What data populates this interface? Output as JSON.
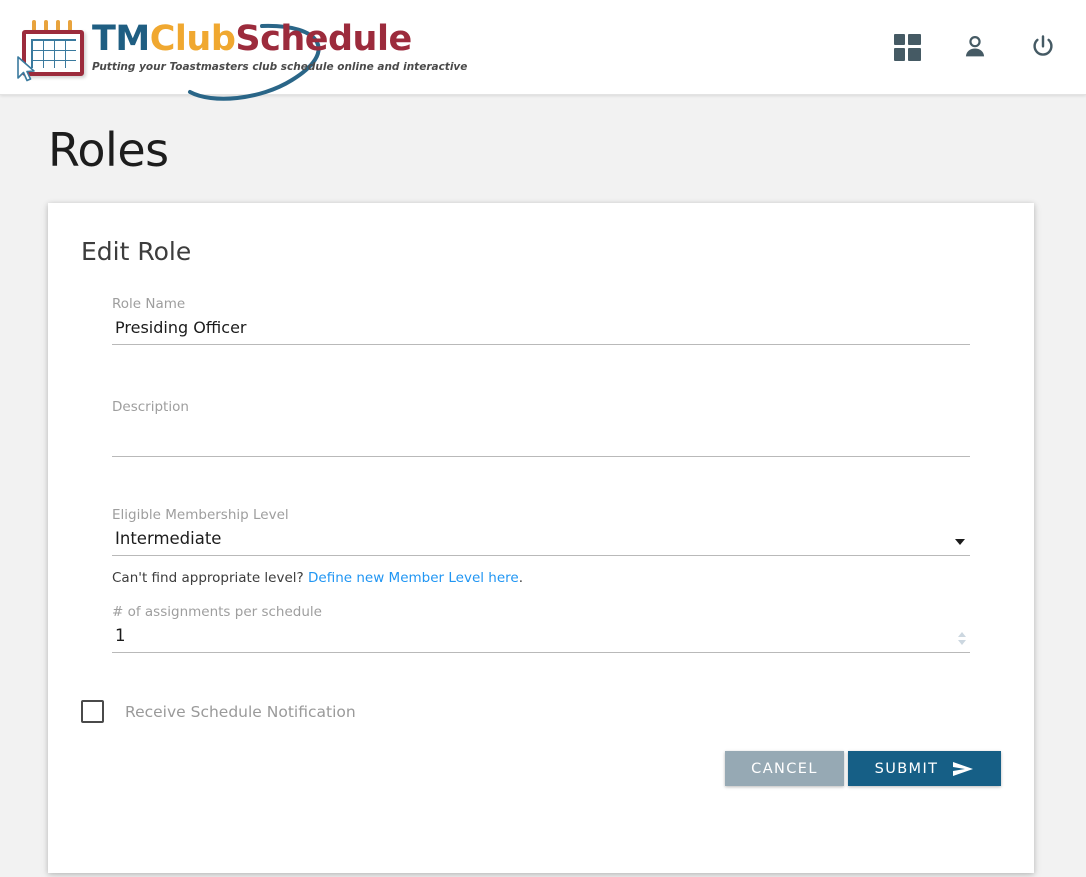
{
  "header": {
    "logo": {
      "wordmark_part1": "TM",
      "wordmark_part2": "Club",
      "wordmark_part3": "Schedule",
      "tagline": "Putting your Toastmasters club schedule online and interactive",
      "colors": {
        "tm": "#1f5e82",
        "club": "#f0a830",
        "schedule": "#9c2b3c",
        "calendar_frame": "#9c2b3c",
        "calendar_grid": "#3a7a9e"
      }
    },
    "actions": [
      {
        "name": "dashboard-icon",
        "label": "Dashboard"
      },
      {
        "name": "account-icon",
        "label": "Account"
      },
      {
        "name": "power-icon",
        "label": "Log out"
      }
    ],
    "icon_color": "#455a64"
  },
  "page": {
    "title": "Roles"
  },
  "card": {
    "title": "Edit Role",
    "fields": {
      "role_name": {
        "label": "Role Name",
        "value": "Presiding Officer",
        "placeholder": ""
      },
      "description": {
        "label": "Description",
        "value": "",
        "placeholder": ""
      },
      "membership_level": {
        "label": "Eligible Membership Level",
        "value": "Intermediate",
        "options": [
          "Intermediate"
        ]
      },
      "assignments": {
        "label": "# of assignments per schedule",
        "value": "1"
      }
    },
    "helper": {
      "text": "Can't find appropriate level?",
      "link_text": "Define new Member Level here",
      "link_suffix": ".",
      "link_color": "#2196f3"
    },
    "checkbox": {
      "label": "Receive Schedule Notification",
      "checked": false
    },
    "buttons": {
      "cancel": {
        "label": "CANCEL",
        "color": "#96a9b4"
      },
      "submit": {
        "label": "SUBMIT",
        "color": "#165f86",
        "icon": "send-icon"
      }
    }
  }
}
